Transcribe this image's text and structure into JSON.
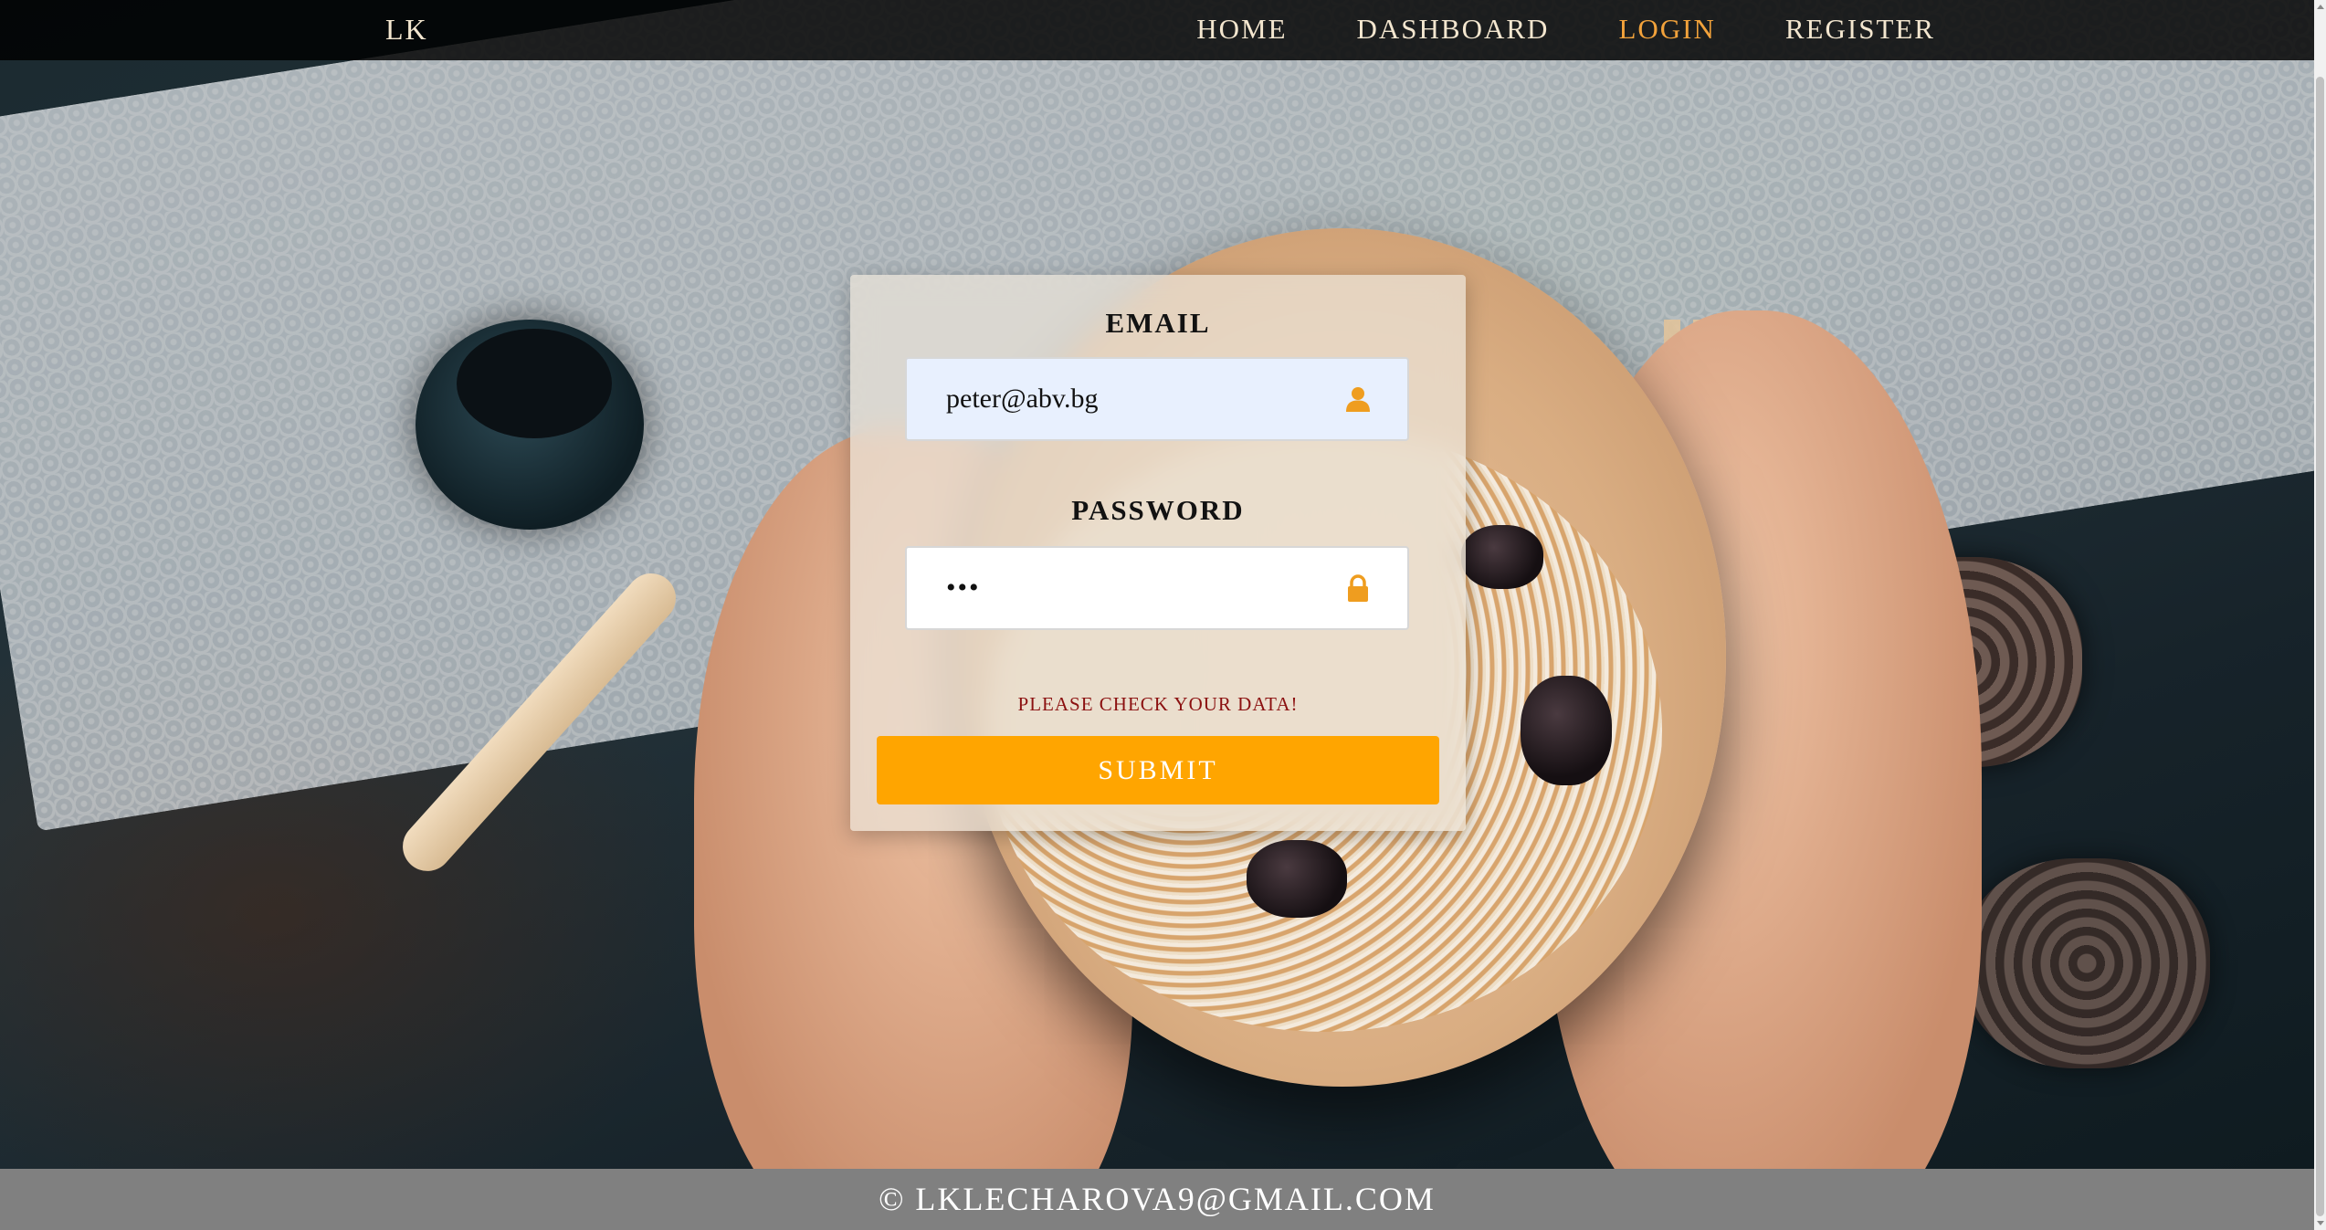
{
  "navbar": {
    "brand": "LK",
    "links": [
      {
        "label": "HOME",
        "active": false
      },
      {
        "label": "DASHBOARD",
        "active": false
      },
      {
        "label": "LOGIN",
        "active": true
      },
      {
        "label": "REGISTER",
        "active": false
      }
    ]
  },
  "login_form": {
    "email_label": "EMAIL",
    "email_value": "peter@abv.bg",
    "email_icon": "user-icon",
    "password_label": "PASSWORD",
    "password_value": "•••",
    "password_icon": "lock-icon",
    "error_message": "PLEASE CHECK YOUR DATA!",
    "submit_label": "SUBMIT"
  },
  "footer": {
    "text": "© LKLECHAROVA9@GMAIL.COM"
  },
  "colors": {
    "accent": "#ffa500",
    "nav_active": "#f2a23b",
    "nav_text": "#f3e6cf",
    "error": "#8b1010",
    "footer_bg": "#808080"
  }
}
